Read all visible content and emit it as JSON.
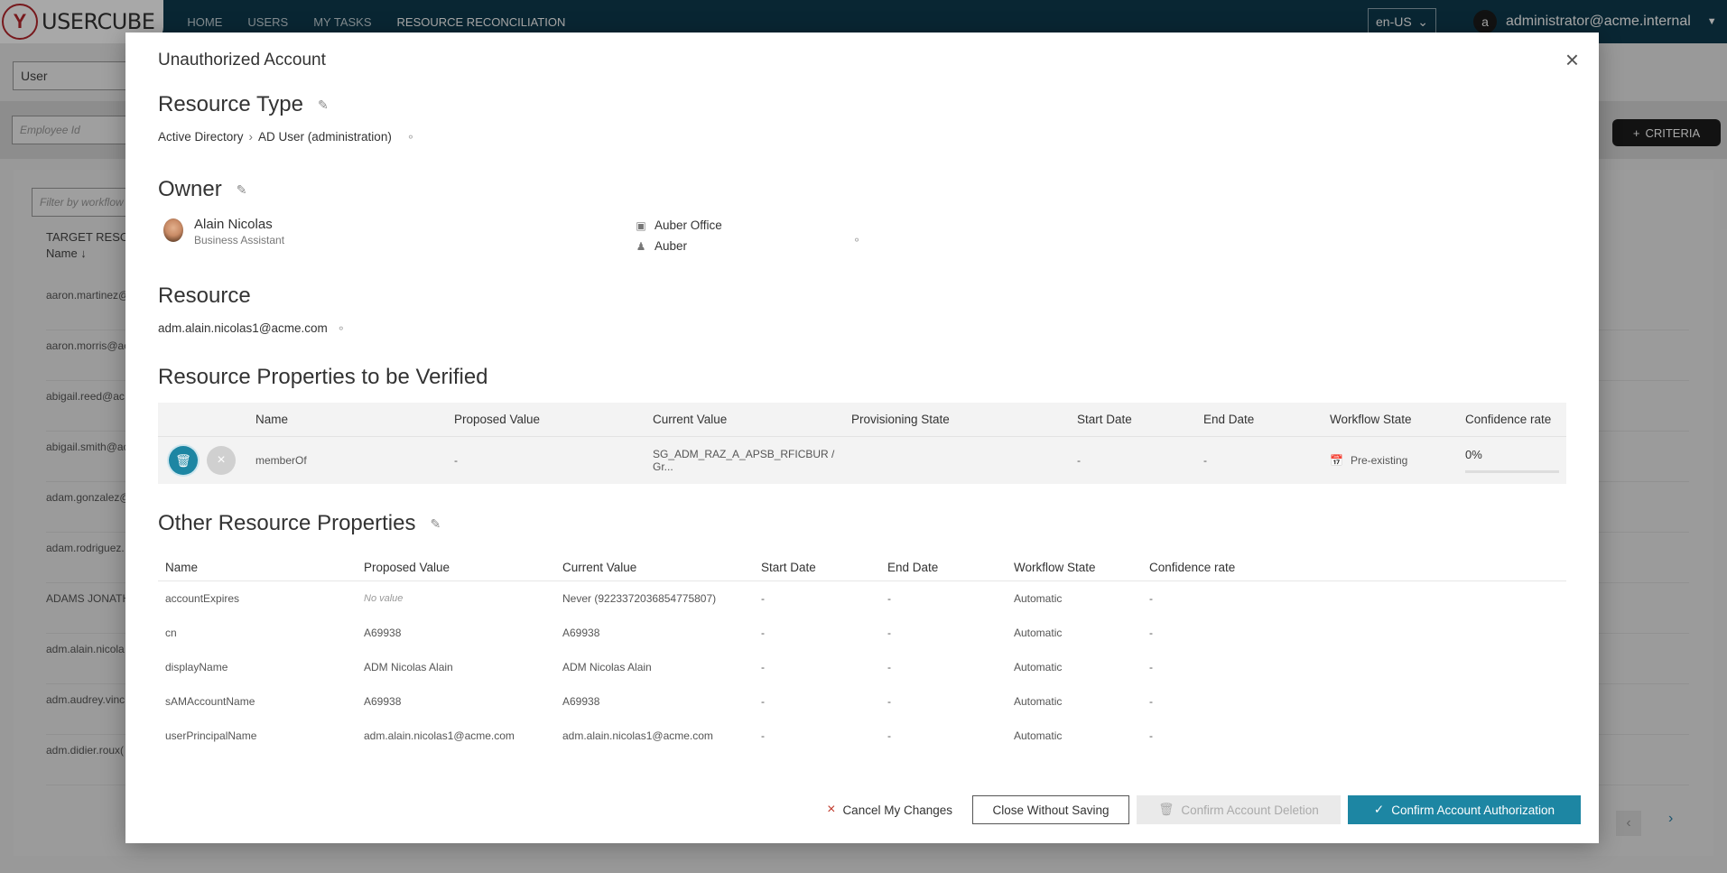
{
  "app": {
    "logo_text": "USERCUBE",
    "nav": [
      "HOME",
      "USERS",
      "MY TASKS",
      "RESOURCE RECONCILIATION"
    ],
    "active_nav": "RESOURCE RECONCILIATION",
    "language": "en-US",
    "user_initial": "a",
    "user_name": "administrator@acme.internal"
  },
  "background": {
    "entity_select": "User",
    "employee_placeholder": "Employee Id",
    "criteria_label": "CRITERIA",
    "workflow_placeholder": "Filter by workflow",
    "column_title": "TARGET RESO",
    "column_sub": "Name ↓",
    "rows": [
      "aaron.martinez@",
      "aaron.morris@ac",
      "abigail.reed@ac",
      "abigail.smith@ac",
      "adam.gonzalez@",
      "adam.rodriguez.",
      "ADAMS JONATH",
      "adm.alain.nicola",
      "adm.audrey.vinc",
      "adm.didier.roux("
    ]
  },
  "modal": {
    "title": "Unauthorized Account",
    "resource_type": {
      "heading": "Resource Type",
      "crumb_1": "Active Directory",
      "crumb_2": "AD User (administration)"
    },
    "owner": {
      "heading": "Owner",
      "name": "Alain Nicolas",
      "title": "Business Assistant",
      "office": "Auber Office",
      "location": "Auber"
    },
    "resource": {
      "heading": "Resource",
      "value": "adm.alain.nicolas1@acme.com"
    },
    "verify": {
      "heading": "Resource Properties to be Verified",
      "columns": [
        "Name",
        "Proposed Value",
        "Current Value",
        "Provisioning State",
        "Start Date",
        "End Date",
        "Workflow State",
        "Confidence rate"
      ],
      "row": {
        "name": "memberOf",
        "proposed": "-",
        "current": "SG_ADM_RAZ_A_APSB_RFICBUR / Gr...",
        "provisioning": "",
        "start": "-",
        "end": "-",
        "workflow": "Pre-existing",
        "confidence": "0%",
        "confidence_fraction": 0
      }
    },
    "other": {
      "heading": "Other Resource Properties",
      "columns": [
        "Name",
        "Proposed Value",
        "Current Value",
        "Start Date",
        "End Date",
        "Workflow State",
        "Confidence rate"
      ],
      "rows": [
        [
          "accountExpires",
          "No value",
          "Never (9223372036854775807)",
          "-",
          "-",
          "Automatic",
          "-"
        ],
        [
          "cn",
          "A69938",
          "A69938",
          "-",
          "-",
          "Automatic",
          "-"
        ],
        [
          "displayName",
          "ADM Nicolas Alain",
          "ADM Nicolas Alain",
          "-",
          "-",
          "Automatic",
          "-"
        ],
        [
          "sAMAccountName",
          "A69938",
          "A69938",
          "-",
          "-",
          "Automatic",
          "-"
        ],
        [
          "userPrincipalName",
          "adm.alain.nicolas1@acme.com",
          "adm.alain.nicolas1@acme.com",
          "-",
          "-",
          "Automatic",
          "-"
        ]
      ]
    },
    "footer": {
      "cancel": "Cancel My Changes",
      "close": "Close Without Saving",
      "delete": "Confirm Account Deletion",
      "confirm": "Confirm Account Authorization"
    }
  },
  "colors": {
    "accent": "#1d86a3",
    "topbar": "#0f3b4e"
  }
}
